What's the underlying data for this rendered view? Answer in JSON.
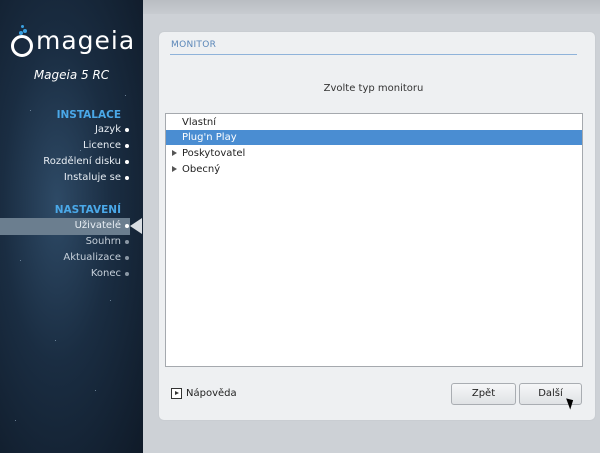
{
  "sidebar": {
    "logo_text": "mageia",
    "version": "Mageia 5 RC",
    "sections": [
      {
        "title": "INSTALACE",
        "items": [
          {
            "label": "Jazyk",
            "state": "done"
          },
          {
            "label": "Licence",
            "state": "done"
          },
          {
            "label": "Rozdělení disku",
            "state": "done"
          },
          {
            "label": "Instaluje se",
            "state": "done"
          }
        ]
      },
      {
        "title": "NASTAVENÍ",
        "items": [
          {
            "label": "Uživatelé",
            "state": "active"
          },
          {
            "label": "Souhrn",
            "state": "pending"
          },
          {
            "label": "Aktualizace",
            "state": "pending"
          },
          {
            "label": "Konec",
            "state": "pending"
          }
        ]
      }
    ]
  },
  "panel": {
    "title": "MONITOR",
    "prompt": "Zvolte typ monitoru",
    "list": [
      {
        "label": "Vlastní",
        "expandable": false,
        "selected": false
      },
      {
        "label": "Plug'n Play",
        "expandable": false,
        "selected": true
      },
      {
        "label": "Poskytovatel",
        "expandable": true,
        "selected": false
      },
      {
        "label": "Obecný",
        "expandable": true,
        "selected": false
      }
    ]
  },
  "footer": {
    "help_label": "Nápověda",
    "back_label": "Zpět",
    "next_label": "Další"
  },
  "colors": {
    "accent": "#4a8dd2",
    "section_title": "#4aa8e8"
  }
}
